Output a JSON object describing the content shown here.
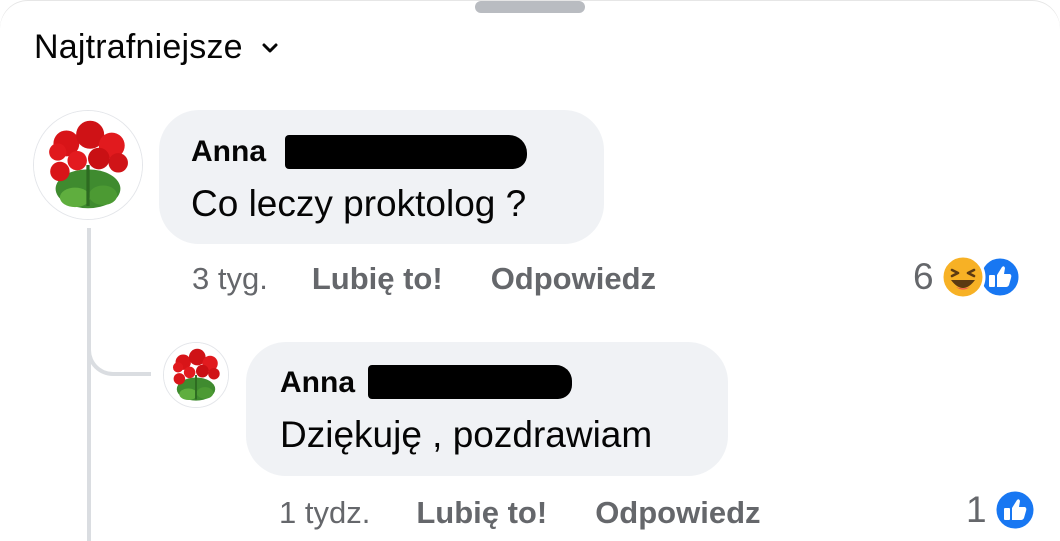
{
  "sort": {
    "label": "Najtrafniejsze"
  },
  "comments": [
    {
      "author": "Anna",
      "text": "Co leczy proktolog ?",
      "time": "3 tyg.",
      "like_label": "Lubię to!",
      "reply_label": "Odpowiedz",
      "reaction_count": "6",
      "reactions": [
        "haha-icon",
        "like-icon"
      ]
    },
    {
      "author": "Anna",
      "text": "Dziękuję , pozdrawiam",
      "time": "1 tydz.",
      "like_label": "Lubię to!",
      "reply_label": "Odpowiedz",
      "reaction_count": "1",
      "reactions": [
        "like-icon"
      ]
    }
  ],
  "colors": {
    "like_blue": "#1877f2",
    "haha_yellow": "#f7b125",
    "meta_gray": "#65676b",
    "bubble_gray": "#f0f2f5"
  }
}
